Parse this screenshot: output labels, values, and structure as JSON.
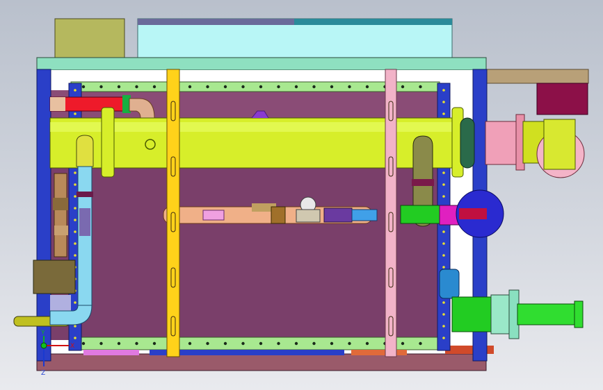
{
  "viewport": {
    "background_top": "#b9c0cc",
    "background_bottom": "#e9eaee"
  },
  "triad": {
    "x_label": "X",
    "y_label": "Y",
    "z_label": "Z",
    "x_color": "#d01010",
    "y_color": "#10b020",
    "z_color": "#1a3ad0"
  },
  "colors": {
    "frame_blue": "#2a3fc8",
    "top_plate": "#8ee0c0",
    "rail_green": "#a8e890",
    "chamber": "#7a3f6a",
    "header_pipe": "#d7ee2a",
    "strap_yellow": "#ffd21a",
    "strap_pink": "#f2b3c8",
    "box_olive": "#b5b85e",
    "box_cyan": "#b8f6f6",
    "motor_maroon": "#8c1048",
    "salmon_bar": "#f0b088",
    "outlet_green": "#22cc22",
    "blue_flange": "#2a2ad0",
    "base": "#9a5a6a"
  },
  "icons": [
    "coordinate-triad-icon"
  ]
}
